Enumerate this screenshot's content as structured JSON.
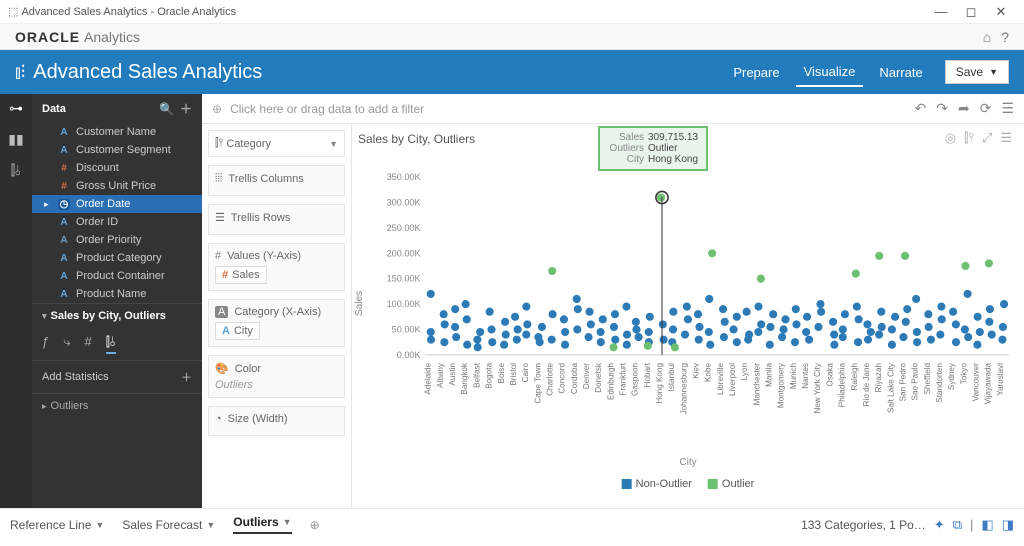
{
  "window": {
    "title": "Advanced Sales Analytics - Oracle Analytics"
  },
  "brand": {
    "vendor": "ORACLE",
    "product": "Analytics"
  },
  "header": {
    "title": "Advanced Sales Analytics",
    "tabs": {
      "prepare": "Prepare",
      "visualize": "Visualize",
      "narrate": "Narrate"
    },
    "save": "Save"
  },
  "leftpanel": {
    "data_label": "Data",
    "fields": [
      {
        "icon": "attr",
        "glyph": "A",
        "label": "Customer Name"
      },
      {
        "icon": "attr",
        "glyph": "A",
        "label": "Customer Segment"
      },
      {
        "icon": "meas",
        "glyph": "#",
        "label": "Discount"
      },
      {
        "icon": "meas",
        "glyph": "#",
        "label": "Gross Unit Price"
      },
      {
        "icon": "date",
        "glyph": "◷",
        "label": "Order Date",
        "active": true
      },
      {
        "icon": "attr",
        "glyph": "A",
        "label": "Order ID"
      },
      {
        "icon": "attr",
        "glyph": "A",
        "label": "Order Priority"
      },
      {
        "icon": "attr",
        "glyph": "A",
        "label": "Product Category"
      },
      {
        "icon": "attr",
        "glyph": "A",
        "label": "Product Container"
      },
      {
        "icon": "attr",
        "glyph": "A",
        "label": "Product Name"
      }
    ],
    "viz_label": "Sales by City, Outliers",
    "add_stats": "Add Statistics",
    "outliers": "Outliers"
  },
  "filterbar": {
    "hint": "Click here or drag data to add a filter"
  },
  "grammar": {
    "viz_type": "Category",
    "trellis_cols": "Trellis Columns",
    "trellis_rows": "Trellis Rows",
    "values_label": "Values (Y-Axis)",
    "values_chip": "Sales",
    "category_label": "Category (X-Axis)",
    "category_chip": "City",
    "color_label": "Color",
    "color_chip": "Outliers",
    "size_label": "Size (Width)"
  },
  "viz": {
    "title": "Sales by City, Outliers",
    "ylabel": "Sales",
    "xlabel": "City",
    "legend": {
      "non_outlier": "Non-Outlier",
      "outlier": "Outlier"
    },
    "tooltip": {
      "sales_k": "Sales",
      "sales_v": "309,715.13",
      "out_k": "Outliers",
      "out_v": "Outlier",
      "city_k": "City",
      "city_v": "Hong Kong"
    }
  },
  "footer": {
    "tabs": {
      "ref": "Reference Line",
      "forecast": "Sales Forecast",
      "outliers": "Outliers"
    },
    "status": "133 Categories, 1 Po…"
  },
  "chart_data": {
    "type": "scatter",
    "xlabel": "City",
    "ylabel": "Sales",
    "title": "Sales by City, Outliers",
    "ylim": [
      0,
      350000
    ],
    "colors": {
      "Non-Outlier": "#2d7bb6",
      "Outlier": "#6cc070"
    },
    "categories": [
      "Adelaide",
      "Albany",
      "Austin",
      "Bangkok",
      "Belfast",
      "Bogota",
      "Boise",
      "Bristol",
      "Cairo",
      "Cape Town",
      "Charlotte",
      "Concord",
      "Cordoba",
      "Denver",
      "Donetsk",
      "Edinburgh",
      "Frankfurt",
      "Gaspoon",
      "Hobart",
      "Hong Kong",
      "Istanbul",
      "Johannesburg",
      "Kiev",
      "Kobe",
      "Libreville",
      "Liverpool",
      "Lyon",
      "Manchester",
      "Manila",
      "Montgomery",
      "Munich",
      "Nantes",
      "New York City",
      "Osaka",
      "Philadelphia",
      "Raleigh",
      "Rio de Jane",
      "Riyazah",
      "Salt Lake City",
      "San Pedro",
      "Sao Paulo",
      "Sheffield",
      "Standorten",
      "Sydney",
      "Tokyo",
      "Vancouver",
      "Vijayawada",
      "Yaroslavl"
    ],
    "series": [
      {
        "name": "Non-Outlier",
        "points": [
          {
            "cat": "Adelaide",
            "y": 120000
          },
          {
            "cat": "Adelaide",
            "y": 45000
          },
          {
            "cat": "Adelaide",
            "y": 30000
          },
          {
            "cat": "Albany",
            "y": 60000
          },
          {
            "cat": "Albany",
            "y": 25000
          },
          {
            "cat": "Albany",
            "y": 80000
          },
          {
            "cat": "Austin",
            "y": 35000
          },
          {
            "cat": "Austin",
            "y": 55000
          },
          {
            "cat": "Austin",
            "y": 90000
          },
          {
            "cat": "Bangkok",
            "y": 70000
          },
          {
            "cat": "Bangkok",
            "y": 20000
          },
          {
            "cat": "Bangkok",
            "y": 100000
          },
          {
            "cat": "Belfast",
            "y": 15000
          },
          {
            "cat": "Belfast",
            "y": 45000
          },
          {
            "cat": "Belfast",
            "y": 30000
          },
          {
            "cat": "Bogota",
            "y": 50000
          },
          {
            "cat": "Bogota",
            "y": 85000
          },
          {
            "cat": "Bogota",
            "y": 25000
          },
          {
            "cat": "Boise",
            "y": 40000
          },
          {
            "cat": "Boise",
            "y": 20000
          },
          {
            "cat": "Boise",
            "y": 65000
          },
          {
            "cat": "Bristol",
            "y": 30000
          },
          {
            "cat": "Bristol",
            "y": 75000
          },
          {
            "cat": "Bristol",
            "y": 50000
          },
          {
            "cat": "Cairo",
            "y": 95000
          },
          {
            "cat": "Cairo",
            "y": 40000
          },
          {
            "cat": "Cairo",
            "y": 60000
          },
          {
            "cat": "Cape Town",
            "y": 25000
          },
          {
            "cat": "Cape Town",
            "y": 55000
          },
          {
            "cat": "Cape Town",
            "y": 35000
          },
          {
            "cat": "Charlotte",
            "y": 80000
          },
          {
            "cat": "Charlotte",
            "y": 30000
          },
          {
            "cat": "Concord",
            "y": 45000
          },
          {
            "cat": "Concord",
            "y": 70000
          },
          {
            "cat": "Concord",
            "y": 20000
          },
          {
            "cat": "Cordoba",
            "y": 90000
          },
          {
            "cat": "Cordoba",
            "y": 110000
          },
          {
            "cat": "Cordoba",
            "y": 50000
          },
          {
            "cat": "Denver",
            "y": 35000
          },
          {
            "cat": "Denver",
            "y": 60000
          },
          {
            "cat": "Denver",
            "y": 85000
          },
          {
            "cat": "Donetsk",
            "y": 25000
          },
          {
            "cat": "Donetsk",
            "y": 45000
          },
          {
            "cat": "Donetsk",
            "y": 70000
          },
          {
            "cat": "Edinburgh",
            "y": 55000
          },
          {
            "cat": "Edinburgh",
            "y": 30000
          },
          {
            "cat": "Edinburgh",
            "y": 80000
          },
          {
            "cat": "Frankfurt",
            "y": 40000
          },
          {
            "cat": "Frankfurt",
            "y": 95000
          },
          {
            "cat": "Frankfurt",
            "y": 20000
          },
          {
            "cat": "Gaspoon",
            "y": 65000
          },
          {
            "cat": "Gaspoon",
            "y": 35000
          },
          {
            "cat": "Gaspoon",
            "y": 50000
          },
          {
            "cat": "Hobart",
            "y": 25000
          },
          {
            "cat": "Hobart",
            "y": 75000
          },
          {
            "cat": "Hobart",
            "y": 45000
          },
          {
            "cat": "Hong Kong",
            "y": 60000
          },
          {
            "cat": "Hong Kong",
            "y": 30000
          },
          {
            "cat": "Istanbul",
            "y": 50000
          },
          {
            "cat": "Istanbul",
            "y": 85000
          },
          {
            "cat": "Istanbul",
            "y": 25000
          },
          {
            "cat": "Johannesburg",
            "y": 40000
          },
          {
            "cat": "Johannesburg",
            "y": 70000
          },
          {
            "cat": "Johannesburg",
            "y": 95000
          },
          {
            "cat": "Kiev",
            "y": 30000
          },
          {
            "cat": "Kiev",
            "y": 55000
          },
          {
            "cat": "Kiev",
            "y": 80000
          },
          {
            "cat": "Kobe",
            "y": 45000
          },
          {
            "cat": "Kobe",
            "y": 20000
          },
          {
            "cat": "Kobe",
            "y": 110000
          },
          {
            "cat": "Libreville",
            "y": 65000
          },
          {
            "cat": "Libreville",
            "y": 35000
          },
          {
            "cat": "Libreville",
            "y": 90000
          },
          {
            "cat": "Liverpool",
            "y": 25000
          },
          {
            "cat": "Liverpool",
            "y": 50000
          },
          {
            "cat": "Liverpool",
            "y": 75000
          },
          {
            "cat": "Lyon",
            "y": 40000
          },
          {
            "cat": "Lyon",
            "y": 85000
          },
          {
            "cat": "Lyon",
            "y": 30000
          },
          {
            "cat": "Manchester",
            "y": 60000
          },
          {
            "cat": "Manchester",
            "y": 95000
          },
          {
            "cat": "Manchester",
            "y": 45000
          },
          {
            "cat": "Manila",
            "y": 20000
          },
          {
            "cat": "Manila",
            "y": 55000
          },
          {
            "cat": "Manila",
            "y": 80000
          },
          {
            "cat": "Montgomery",
            "y": 35000
          },
          {
            "cat": "Montgomery",
            "y": 70000
          },
          {
            "cat": "Montgomery",
            "y": 50000
          },
          {
            "cat": "Munich",
            "y": 90000
          },
          {
            "cat": "Munich",
            "y": 25000
          },
          {
            "cat": "Munich",
            "y": 60000
          },
          {
            "cat": "Nantes",
            "y": 45000
          },
          {
            "cat": "Nantes",
            "y": 75000
          },
          {
            "cat": "Nantes",
            "y": 30000
          },
          {
            "cat": "New York City",
            "y": 100000
          },
          {
            "cat": "New York City",
            "y": 55000
          },
          {
            "cat": "New York City",
            "y": 85000
          },
          {
            "cat": "Osaka",
            "y": 40000
          },
          {
            "cat": "Osaka",
            "y": 20000
          },
          {
            "cat": "Osaka",
            "y": 65000
          },
          {
            "cat": "Philadelphia",
            "y": 50000
          },
          {
            "cat": "Philadelphia",
            "y": 80000
          },
          {
            "cat": "Philadelphia",
            "y": 35000
          },
          {
            "cat": "Raleigh",
            "y": 70000
          },
          {
            "cat": "Raleigh",
            "y": 25000
          },
          {
            "cat": "Raleigh",
            "y": 95000
          },
          {
            "cat": "Rio de Jane",
            "y": 45000
          },
          {
            "cat": "Rio de Jane",
            "y": 60000
          },
          {
            "cat": "Rio de Jane",
            "y": 30000
          },
          {
            "cat": "Riyazah",
            "y": 85000
          },
          {
            "cat": "Riyazah",
            "y": 55000
          },
          {
            "cat": "Riyazah",
            "y": 40000
          },
          {
            "cat": "Salt Lake City",
            "y": 20000
          },
          {
            "cat": "Salt Lake City",
            "y": 75000
          },
          {
            "cat": "Salt Lake City",
            "y": 50000
          },
          {
            "cat": "San Pedro",
            "y": 65000
          },
          {
            "cat": "San Pedro",
            "y": 35000
          },
          {
            "cat": "San Pedro",
            "y": 90000
          },
          {
            "cat": "Sao Paulo",
            "y": 110000
          },
          {
            "cat": "Sao Paulo",
            "y": 45000
          },
          {
            "cat": "Sao Paulo",
            "y": 25000
          },
          {
            "cat": "Sheffield",
            "y": 55000
          },
          {
            "cat": "Sheffield",
            "y": 80000
          },
          {
            "cat": "Sheffield",
            "y": 30000
          },
          {
            "cat": "Standorten",
            "y": 70000
          },
          {
            "cat": "Standorten",
            "y": 40000
          },
          {
            "cat": "Standorten",
            "y": 95000
          },
          {
            "cat": "Sydney",
            "y": 25000
          },
          {
            "cat": "Sydney",
            "y": 60000
          },
          {
            "cat": "Sydney",
            "y": 85000
          },
          {
            "cat": "Tokyo",
            "y": 50000
          },
          {
            "cat": "Tokyo",
            "y": 120000
          },
          {
            "cat": "Tokyo",
            "y": 35000
          },
          {
            "cat": "Vancouver",
            "y": 45000
          },
          {
            "cat": "Vancouver",
            "y": 75000
          },
          {
            "cat": "Vancouver",
            "y": 20000
          },
          {
            "cat": "Vijayawada",
            "y": 65000
          },
          {
            "cat": "Vijayawada",
            "y": 90000
          },
          {
            "cat": "Vijayawada",
            "y": 40000
          },
          {
            "cat": "Yaroslavl",
            "y": 100000
          },
          {
            "cat": "Yaroslavl",
            "y": 55000
          },
          {
            "cat": "Yaroslavl",
            "y": 30000
          }
        ]
      },
      {
        "name": "Outlier",
        "points": [
          {
            "cat": "Charlotte",
            "y": 165000
          },
          {
            "cat": "Edinburgh",
            "y": 15000
          },
          {
            "cat": "Hobart",
            "y": 18000
          },
          {
            "cat": "Hong Kong",
            "y": 309715
          },
          {
            "cat": "Istanbul",
            "y": 15000
          },
          {
            "cat": "Kobe",
            "y": 200000
          },
          {
            "cat": "Manchester",
            "y": 150000
          },
          {
            "cat": "Raleigh",
            "y": 160000
          },
          {
            "cat": "Riyazah",
            "y": 195000
          },
          {
            "cat": "San Pedro",
            "y": 195000
          },
          {
            "cat": "Tokyo",
            "y": 175000
          },
          {
            "cat": "Vijayawada",
            "y": 180000
          }
        ]
      }
    ]
  }
}
